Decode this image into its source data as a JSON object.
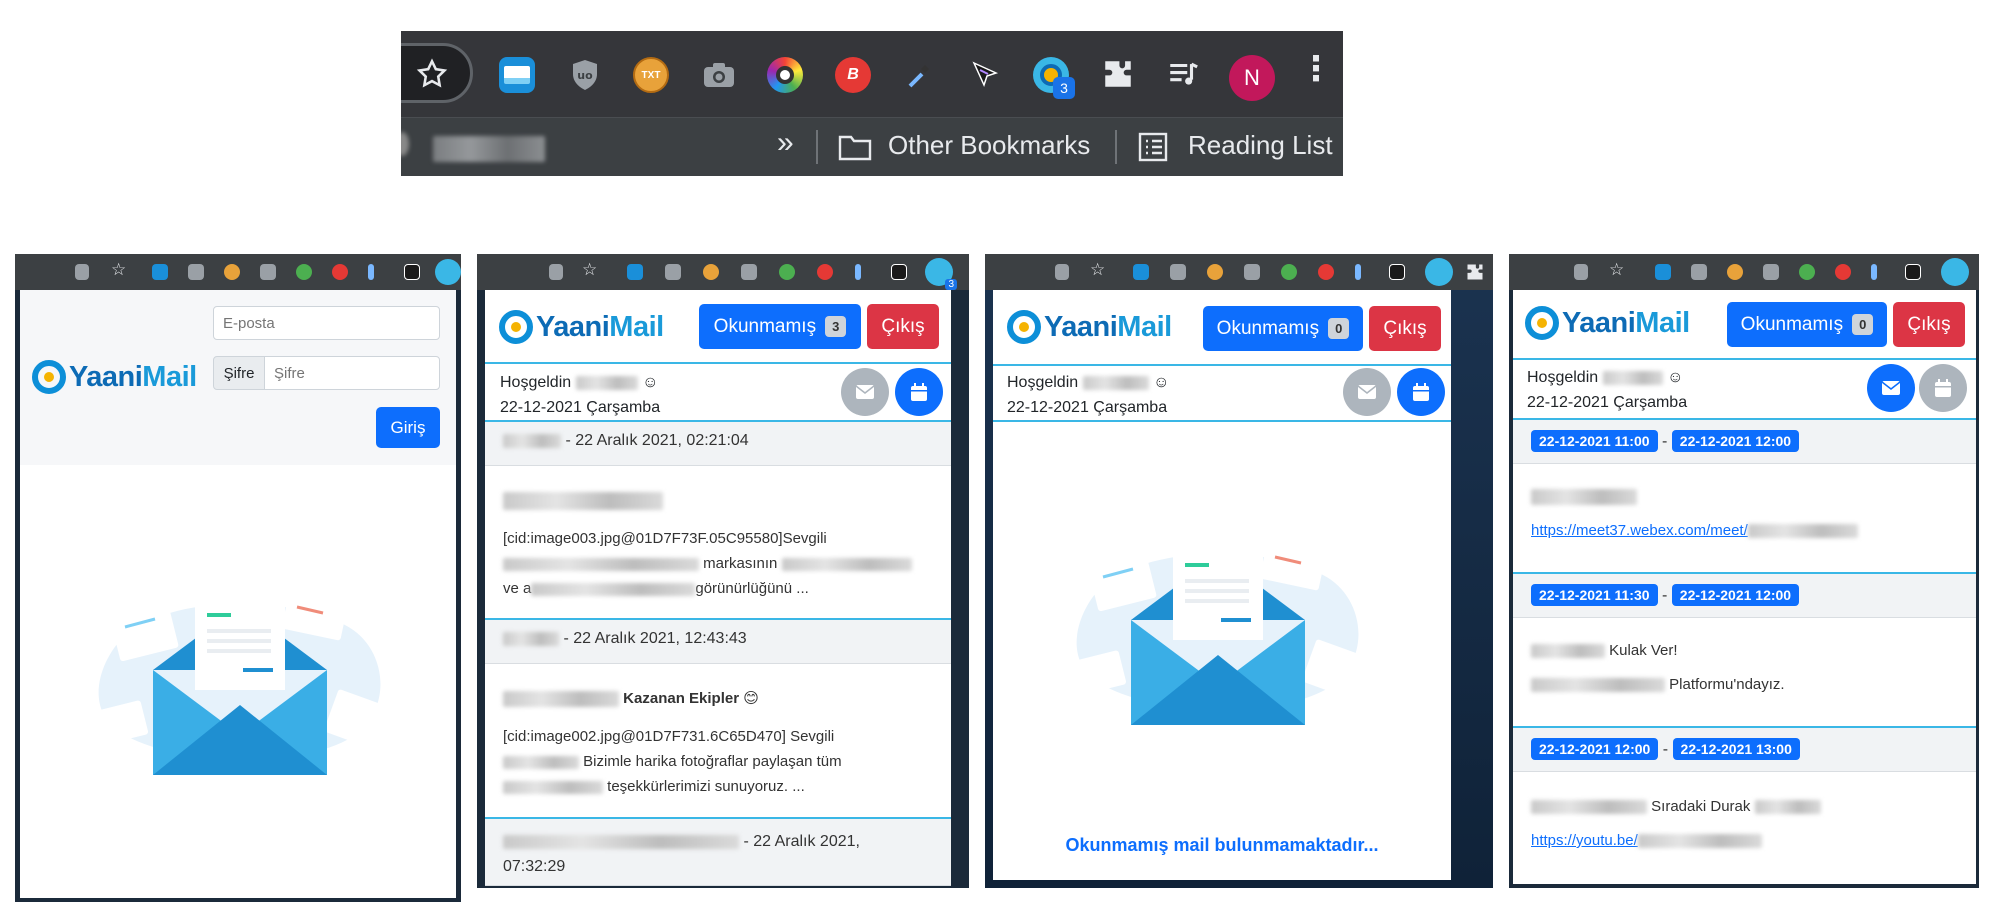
{
  "top_toolbar": {
    "extensions": [
      "star-icon",
      "whiteboard-extension-icon",
      "ublock-extension-icon",
      "txt-extension-icon",
      "camera-extension-icon",
      "color-picker-extension-icon",
      "b-extension-icon",
      "eyedropper-extension-icon",
      "cursor-extension-icon",
      "yaanimail-extension-icon",
      "puzzle-icon",
      "reading-mode-icon"
    ],
    "yaanimail_badge": "3",
    "avatar_letter": "N",
    "more_glyph": "⋮",
    "overflow_glyph": "»",
    "other_bookmarks": "Other Bookmarks",
    "reading_list": "Reading List"
  },
  "colors": {
    "primary": "#0d6efd",
    "danger": "#dc3545",
    "accent_line": "#3ab7e6",
    "avatar": "#c2185b"
  },
  "brand": {
    "name_a": "Yaani",
    "name_b": "Mail"
  },
  "login_panel": {
    "email_placeholder": "E-posta",
    "password_label": "Şifre",
    "password_placeholder": "Şifre",
    "login_button": "Giriş"
  },
  "header": {
    "unread_label": "Okunmamış",
    "logout_label": "Çıkış",
    "welcome": "Hoşgeldin",
    "smiley": "☺",
    "date": "22-12-2021 Çarşamba"
  },
  "panel2": {
    "unread_count": "3",
    "mini_badge": "3",
    "mails": [
      {
        "meta": "- 22 Aralık 2021, 02:21:04",
        "body_line1": "[cid:image003.jpg@01D7F73F.05C95580]Sevgili",
        "body_line2": "markasının",
        "body_line3_a": "ve a",
        "body_line3_b": "görünürlüğünü ..."
      },
      {
        "meta": "- 22 Aralık 2021, 12:43:43",
        "subject": "Kazanan Ekipler 😊",
        "body_line1": "[cid:image002.jpg@01D7F731.6C65D470] Sevgili",
        "body_line2": "Bizimle harika fotoğraflar paylaşan tüm",
        "body_line3": "teşekkürlerimizi sunuyoruz. ..."
      },
      {
        "meta": "- 22 Aralık 2021,",
        "meta2": "07:32:29"
      }
    ]
  },
  "panel3": {
    "unread_count": "0",
    "empty_message": "Okunmamış mail bulunmamaktadır..."
  },
  "panel4": {
    "unread_count": "0",
    "events": [
      {
        "start": "22-12-2021 11:00",
        "end": "22-12-2021 12:00",
        "link": "https://meet37.webex.com/meet/"
      },
      {
        "start": "22-12-2021 11:30",
        "end": "22-12-2021 12:00",
        "line1": "Kulak Ver!",
        "line2": "Platformu'ndayız."
      },
      {
        "start": "22-12-2021 12:00",
        "end": "22-12-2021 13:00",
        "line1": "Sıradaki Durak",
        "link": "https://youtu.be/"
      }
    ],
    "separator": "-"
  }
}
